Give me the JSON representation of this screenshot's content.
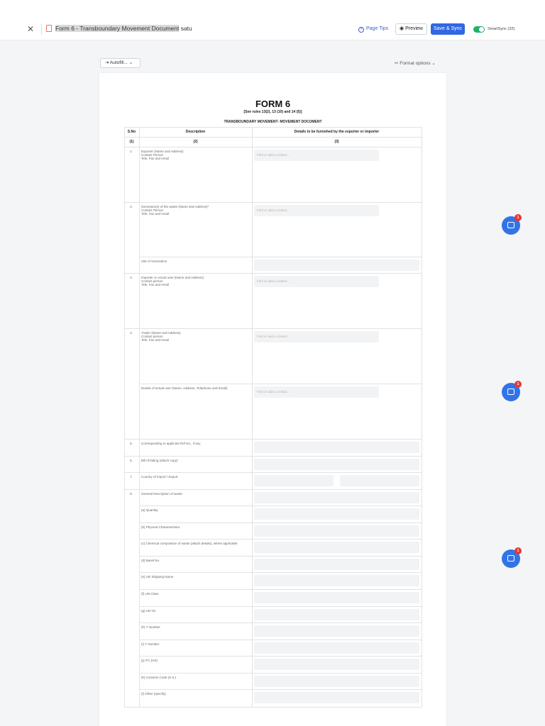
{
  "header": {
    "title_highlighted": "Form 6 - Transboundary Movement Document",
    "title_rest": " satu",
    "page_tips": "Page Tips",
    "preview": "Preview",
    "save_sync": "Save & Sync",
    "smartsync": "SmartSync (32)"
  },
  "toolbar": {
    "autofill": "Autofill...",
    "format_options": "Format options"
  },
  "form": {
    "title": "FORM 6",
    "rules": "[See rules 13(2), 13 (10) and 14 (5)]",
    "subtitle": "TRANSBOUNDARY MOVEMENT- MOVEMENT DOCUMENT",
    "col_sno": "S.No",
    "col_desc": "Description",
    "col_details": "Details to be furnished by the exporter or importer",
    "col_num_1": "(1)",
    "col_num_2": "(2)",
    "col_num_3": "(3)",
    "contact_placeholder": "Find or add a contact..."
  },
  "rows": [
    {
      "sno": "1.",
      "desc": "Exporter (Name and Address)\nContact Person\nTele, Fax and email"
    },
    {
      "sno": "2.",
      "desc": "Generator(s) of the waste (Name and Address)*\nContact Person\nTele, Fax and email"
    },
    {
      "sno": "",
      "desc": "Site of Generation"
    },
    {
      "sno": "3.",
      "desc": "Importer or Actual user (Name and Address)\nContact person\nTele, Fax and email"
    },
    {
      "sno": "4.",
      "desc": "Trader (Name and Address)\nContact person\nTele, Fax and email"
    },
    {
      "sno": "",
      "desc": "Details of actual user (Name, Address, Telephone and Email)"
    },
    {
      "sno": "5.",
      "desc": "Corresponding to applicant Ref No., if any"
    },
    {
      "sno": "6.",
      "desc": "Bill of lading (attach copy)"
    },
    {
      "sno": "7.",
      "desc": "Country of Import / Export"
    },
    {
      "sno": "8.",
      "desc": "General Description of waste"
    },
    {
      "sno": "",
      "desc": "(a) Quantity"
    },
    {
      "sno": "",
      "desc": "(b) Physical Characteristics"
    },
    {
      "sno": "",
      "desc": "(c) Chemical composition of waste (attach details), where applicable"
    },
    {
      "sno": "",
      "desc": "(d) Basel No."
    },
    {
      "sno": "",
      "desc": "(e) UN Shipping Name"
    },
    {
      "sno": "",
      "desc": "(f) UN Class"
    },
    {
      "sno": "",
      "desc": "(g) UN No"
    },
    {
      "sno": "",
      "desc": "(h) Y Number"
    },
    {
      "sno": "",
      "desc": "(i) Y Number"
    },
    {
      "sno": "",
      "desc": "(j) ITC (HS)"
    },
    {
      "sno": "",
      "desc": "(k) Customs Code (H.S.)"
    },
    {
      "sno": "",
      "desc": "(l) Other (specify)"
    }
  ],
  "chat_widgets": [
    {
      "badge": "1"
    },
    {
      "badge": "1"
    },
    {
      "badge": "1"
    }
  ]
}
